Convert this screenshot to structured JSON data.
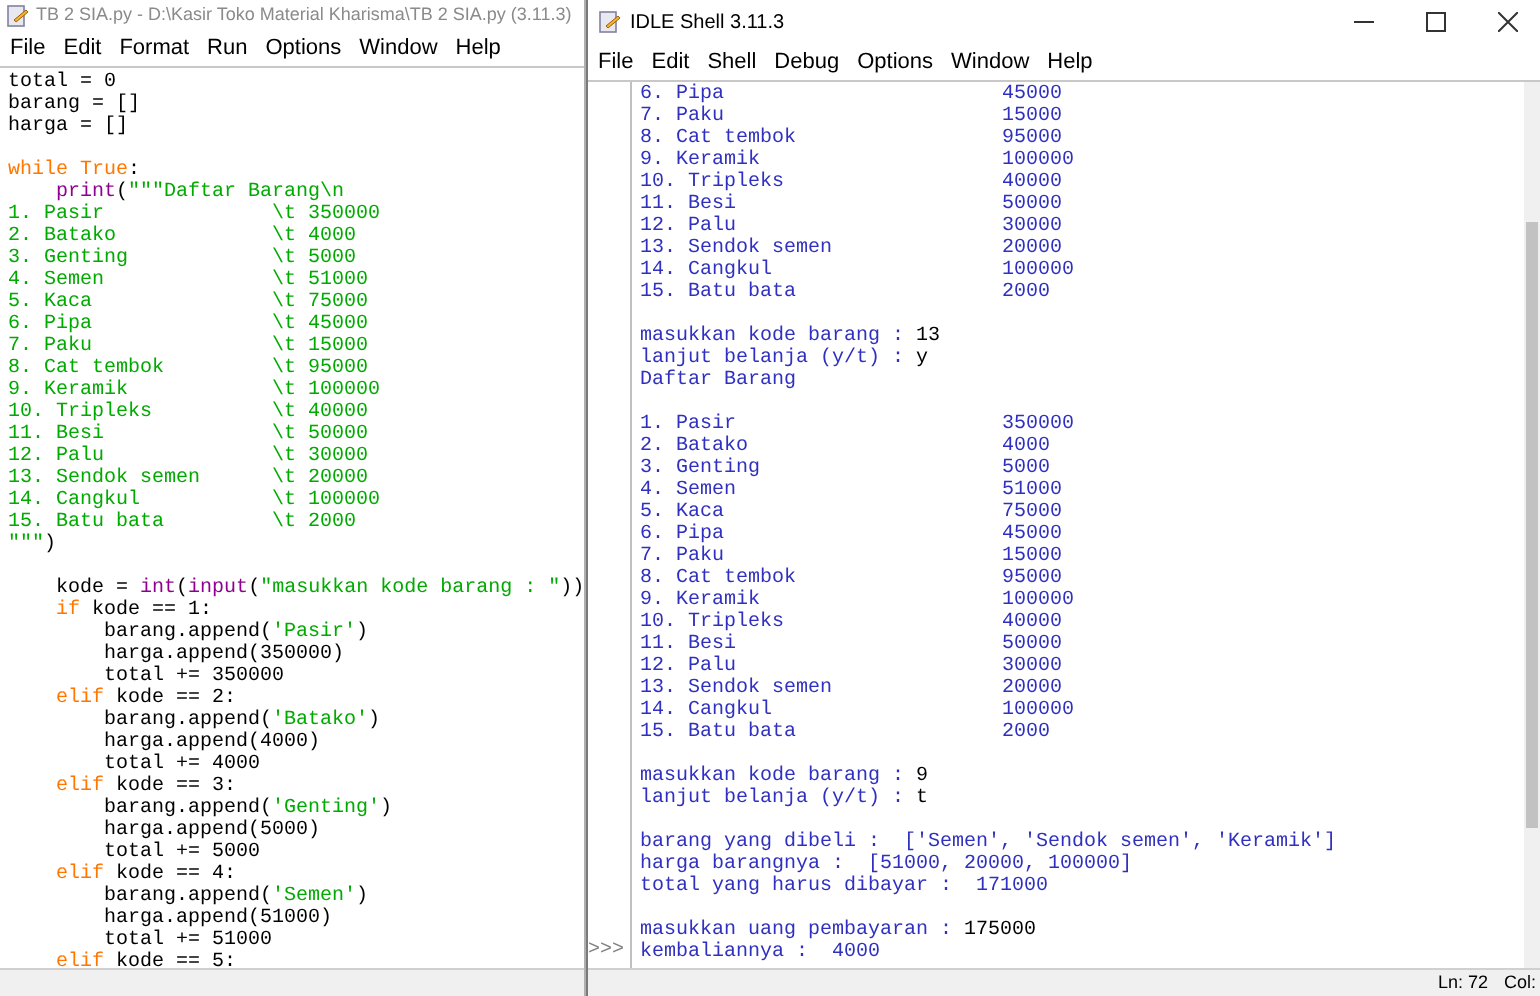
{
  "editor": {
    "title": "TB 2 SIA.py - D:\\Kasir Toko Material Kharisma\\TB 2 SIA.py (3.11.3)",
    "menu": [
      "File",
      "Edit",
      "Format",
      "Run",
      "Options",
      "Window",
      "Help"
    ],
    "code": [
      {
        "segments": [
          {
            "text": "total = 0",
            "kind": "plain"
          }
        ]
      },
      {
        "segments": [
          {
            "text": "barang = []",
            "kind": "plain"
          }
        ]
      },
      {
        "segments": [
          {
            "text": "harga = []",
            "kind": "plain"
          }
        ]
      },
      {
        "kind": "blank"
      },
      {
        "segments": [
          {
            "text": "while True",
            "kind": "kw"
          },
          {
            "text": ":",
            "kind": "plain"
          }
        ]
      },
      {
        "segments": [
          {
            "text": "    print",
            "kind": "builtin"
          },
          {
            "text": "(",
            "kind": "plain"
          },
          {
            "text": "\"\"\"Daftar Barang\\n",
            "kind": "str"
          }
        ]
      },
      {
        "segments": [
          {
            "text": "1. Pasir              \\t 350000",
            "kind": "str"
          }
        ]
      },
      {
        "segments": [
          {
            "text": "2. Batako             \\t 4000",
            "kind": "str"
          }
        ]
      },
      {
        "segments": [
          {
            "text": "3. Genting            \\t 5000",
            "kind": "str"
          }
        ]
      },
      {
        "segments": [
          {
            "text": "4. Semen              \\t 51000",
            "kind": "str"
          }
        ]
      },
      {
        "segments": [
          {
            "text": "5. Kaca               \\t 75000",
            "kind": "str"
          }
        ]
      },
      {
        "segments": [
          {
            "text": "6. Pipa               \\t 45000",
            "kind": "str"
          }
        ]
      },
      {
        "segments": [
          {
            "text": "7. Paku               \\t 15000",
            "kind": "str"
          }
        ]
      },
      {
        "segments": [
          {
            "text": "8. Cat tembok         \\t 95000",
            "kind": "str"
          }
        ]
      },
      {
        "segments": [
          {
            "text": "9. Keramik            \\t 100000",
            "kind": "str"
          }
        ]
      },
      {
        "segments": [
          {
            "text": "10. Tripleks          \\t 40000",
            "kind": "str"
          }
        ]
      },
      {
        "segments": [
          {
            "text": "11. Besi              \\t 50000",
            "kind": "str"
          }
        ]
      },
      {
        "segments": [
          {
            "text": "12. Palu              \\t 30000",
            "kind": "str"
          }
        ]
      },
      {
        "segments": [
          {
            "text": "13. Sendok semen      \\t 20000",
            "kind": "str"
          }
        ]
      },
      {
        "segments": [
          {
            "text": "14. Cangkul           \\t 100000",
            "kind": "str"
          }
        ]
      },
      {
        "segments": [
          {
            "text": "15. Batu bata         \\t 2000",
            "kind": "str"
          }
        ]
      },
      {
        "segments": [
          {
            "text": "\"\"\"",
            "kind": "str"
          },
          {
            "text": ")",
            "kind": "plain"
          }
        ]
      },
      {
        "kind": "blank"
      },
      {
        "segments": [
          {
            "text": "    kode = ",
            "kind": "plain"
          },
          {
            "text": "int",
            "kind": "builtin"
          },
          {
            "text": "(",
            "kind": "plain"
          },
          {
            "text": "input",
            "kind": "builtin"
          },
          {
            "text": "(",
            "kind": "plain"
          },
          {
            "text": "\"masukkan kode barang : \"",
            "kind": "str"
          },
          {
            "text": "))",
            "kind": "plain"
          }
        ]
      },
      {
        "segments": [
          {
            "text": "    if",
            "kind": "kw"
          },
          {
            "text": " kode == 1:",
            "kind": "plain"
          }
        ]
      },
      {
        "segments": [
          {
            "text": "        barang.append(",
            "kind": "plain"
          },
          {
            "text": "'Pasir'",
            "kind": "str"
          },
          {
            "text": ")",
            "kind": "plain"
          }
        ]
      },
      {
        "segments": [
          {
            "text": "        harga.append(350000)",
            "kind": "plain"
          }
        ]
      },
      {
        "segments": [
          {
            "text": "        total += 350000",
            "kind": "plain"
          }
        ]
      },
      {
        "segments": [
          {
            "text": "    elif",
            "kind": "kw"
          },
          {
            "text": " kode == 2:",
            "kind": "plain"
          }
        ]
      },
      {
        "segments": [
          {
            "text": "        barang.append(",
            "kind": "plain"
          },
          {
            "text": "'Batako'",
            "kind": "str"
          },
          {
            "text": ")",
            "kind": "plain"
          }
        ]
      },
      {
        "segments": [
          {
            "text": "        harga.append(4000)",
            "kind": "plain"
          }
        ]
      },
      {
        "segments": [
          {
            "text": "        total += 4000",
            "kind": "plain"
          }
        ]
      },
      {
        "segments": [
          {
            "text": "    elif",
            "kind": "kw"
          },
          {
            "text": " kode == 3:",
            "kind": "plain"
          }
        ]
      },
      {
        "segments": [
          {
            "text": "        barang.append(",
            "kind": "plain"
          },
          {
            "text": "'Genting'",
            "kind": "str"
          },
          {
            "text": ")",
            "kind": "plain"
          }
        ]
      },
      {
        "segments": [
          {
            "text": "        harga.append(5000)",
            "kind": "plain"
          }
        ]
      },
      {
        "segments": [
          {
            "text": "        total += 5000",
            "kind": "plain"
          }
        ]
      },
      {
        "segments": [
          {
            "text": "    elif",
            "kind": "kw"
          },
          {
            "text": " kode == 4:",
            "kind": "plain"
          }
        ]
      },
      {
        "segments": [
          {
            "text": "        barang.append(",
            "kind": "plain"
          },
          {
            "text": "'Semen'",
            "kind": "str"
          },
          {
            "text": ")",
            "kind": "plain"
          }
        ]
      },
      {
        "segments": [
          {
            "text": "        harga.append(51000)",
            "kind": "plain"
          }
        ]
      },
      {
        "segments": [
          {
            "text": "        total += 51000",
            "kind": "plain"
          }
        ]
      },
      {
        "segments": [
          {
            "text": "    elif",
            "kind": "kw"
          },
          {
            "text": " kode == 5:",
            "kind": "plain"
          }
        ]
      }
    ]
  },
  "shell": {
    "title": "IDLE Shell 3.11.3",
    "menu": [
      "File",
      "Edit",
      "Shell",
      "Debug",
      "Options",
      "Window",
      "Help"
    ],
    "output": [
      {
        "kind": "item",
        "name": "6. Pipa",
        "value": "45000"
      },
      {
        "kind": "item",
        "name": "7. Paku",
        "value": "15000"
      },
      {
        "kind": "item",
        "name": "8. Cat tembok",
        "value": "95000"
      },
      {
        "kind": "item",
        "name": "9. Keramik",
        "value": "100000"
      },
      {
        "kind": "item",
        "name": "10. Tripleks",
        "value": "40000"
      },
      {
        "kind": "item",
        "name": "11. Besi",
        "value": "50000"
      },
      {
        "kind": "item",
        "name": "12. Palu",
        "value": "30000"
      },
      {
        "kind": "item",
        "name": "13. Sendok semen",
        "value": "20000"
      },
      {
        "kind": "item",
        "name": "14. Cangkul",
        "value": "100000"
      },
      {
        "kind": "item",
        "name": "15. Batu bata",
        "value": "2000"
      },
      {
        "kind": "blank"
      },
      {
        "kind": "prompt",
        "text": "masukkan kode barang : ",
        "input": "13"
      },
      {
        "kind": "prompt",
        "text": "lanjut belanja (y/t) : ",
        "input": "y"
      },
      {
        "kind": "text",
        "text": "Daftar Barang"
      },
      {
        "kind": "blank"
      },
      {
        "kind": "item",
        "name": "1. Pasir",
        "value": "350000"
      },
      {
        "kind": "item",
        "name": "2. Batako",
        "value": "4000"
      },
      {
        "kind": "item",
        "name": "3. Genting",
        "value": "5000"
      },
      {
        "kind": "item",
        "name": "4. Semen",
        "value": "51000"
      },
      {
        "kind": "item",
        "name": "5. Kaca",
        "value": "75000"
      },
      {
        "kind": "item",
        "name": "6. Pipa",
        "value": "45000"
      },
      {
        "kind": "item",
        "name": "7. Paku",
        "value": "15000"
      },
      {
        "kind": "item",
        "name": "8. Cat tembok",
        "value": "95000"
      },
      {
        "kind": "item",
        "name": "9. Keramik",
        "value": "100000"
      },
      {
        "kind": "item",
        "name": "10. Tripleks",
        "value": "40000"
      },
      {
        "kind": "item",
        "name": "11. Besi",
        "value": "50000"
      },
      {
        "kind": "item",
        "name": "12. Palu",
        "value": "30000"
      },
      {
        "kind": "item",
        "name": "13. Sendok semen",
        "value": "20000"
      },
      {
        "kind": "item",
        "name": "14. Cangkul",
        "value": "100000"
      },
      {
        "kind": "item",
        "name": "15. Batu bata",
        "value": "2000"
      },
      {
        "kind": "blank"
      },
      {
        "kind": "prompt",
        "text": "masukkan kode barang : ",
        "input": "9"
      },
      {
        "kind": "prompt",
        "text": "lanjut belanja (y/t) : ",
        "input": "t"
      },
      {
        "kind": "blank"
      },
      {
        "kind": "text",
        "text": "barang yang dibeli :  ['Semen', 'Sendok semen', 'Keramik']"
      },
      {
        "kind": "text",
        "text": "harga barangnya :  [51000, 20000, 100000]"
      },
      {
        "kind": "text",
        "text": "total yang harus dibayar :  171000"
      },
      {
        "kind": "blank"
      },
      {
        "kind": "prompt",
        "text": "masukkan uang pembayaran : ",
        "input": "175000"
      },
      {
        "kind": "text",
        "text": "kembaliannya :  4000"
      }
    ],
    "prompt": ">>>",
    "status": {
      "line": "Ln: 72",
      "col": "Col:"
    }
  }
}
